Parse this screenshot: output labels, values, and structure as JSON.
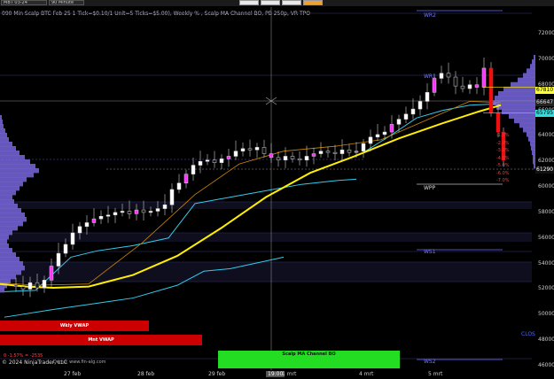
{
  "toolbar": {
    "instrument": "MBT 03-24",
    "timeframe": "90 Minute",
    "buttons": [
      "",
      "",
      "",
      "",
      ""
    ]
  },
  "chart_info": "090 Min Scalp BTC Feb 25 1 Tick=$0.10/1 Unit=5 Ticks=$5.00), Weekly % , Scalp MA Channel BO, PB 250p, VR TPO",
  "labels": {
    "wr2": "WR2",
    "ws1": "WS1",
    "ws2": "WS2",
    "wpp": "WPP",
    "wr1": "WR1",
    "wkly_vwap": "Wkly VWAP",
    "mnt_vwap": "Mnt VWAP",
    "scalp_channel": "Scalp MA Channel BO",
    "clos": "CLOS",
    "perf": "0 -1.57% = -2535",
    "copyright": "© 2024 NinjaTrader, LLC",
    "link": "Demo: www.fin-alg.com"
  },
  "price_axis": {
    "ticks": [
      "72000",
      "70000",
      "68000",
      "66000",
      "64000",
      "62000",
      "60000",
      "58000",
      "56000",
      "54000",
      "52000",
      "50000",
      "48000",
      "46000"
    ],
    "badges": [
      {
        "text": "67810",
        "bg": "#ffff33",
        "fg": "#000"
      },
      {
        "text": "66647",
        "bg": "#222",
        "fg": "#ddd"
      },
      {
        "text": "65795",
        "bg": "#33dddd",
        "fg": "#000"
      },
      {
        "text": "61290",
        "bg": "#111",
        "fg": "#fff"
      }
    ]
  },
  "pct_levels": [
    "-1.0%",
    "-2.0%",
    "-3.0%",
    "-4.0%",
    "-5.0%",
    "-6.0%",
    "-7.0%"
  ],
  "date_axis": [
    "27 feb",
    "28 feb",
    "29 feb",
    "19:00",
    "1 mrt",
    "4 mrt",
    "5 mrt"
  ],
  "colors": {
    "background": "#000000",
    "bull": "#ffffff",
    "bear": "#111111",
    "volume_profile": "#7766dd",
    "channel": "#33ccee",
    "ma_slow": "#ffee00",
    "ma_fast": "#cc8800",
    "wkly_vwap": "#cc0000",
    "mnt_vwap": "#cc0000",
    "scalp_band": "#22dd22",
    "pivot": "#6a6aff"
  }
}
